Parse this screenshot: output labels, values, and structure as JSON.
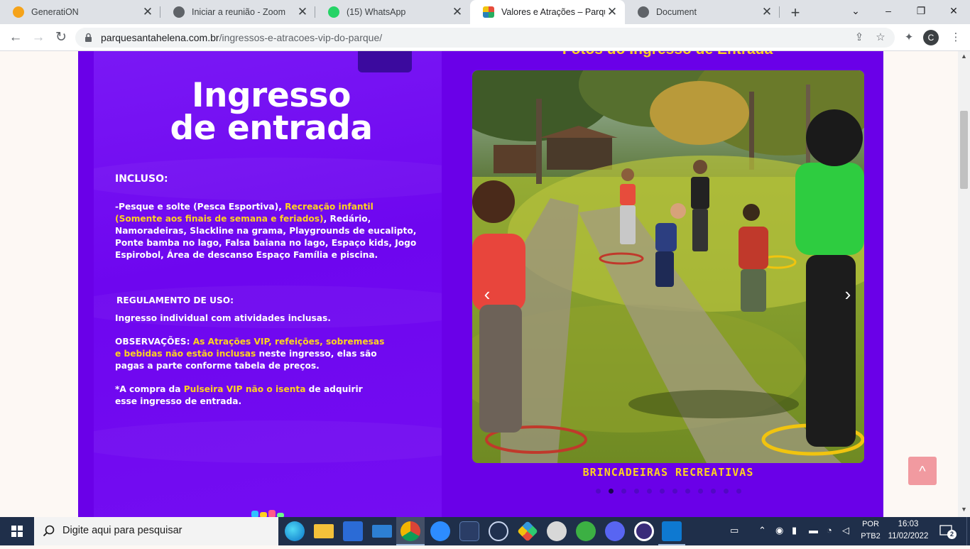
{
  "browser": {
    "tabs": [
      {
        "title": "GeneratiON",
        "favicon_color": "#f5a31a",
        "active": false
      },
      {
        "title": "Iniciar a reunião - Zoom",
        "favicon_color": "#5f6368",
        "active": false
      },
      {
        "title": "(15) WhatsApp",
        "favicon_color": "#25d366",
        "active": false
      },
      {
        "title": "Valores e Atrações – Parque Sa",
        "favicon_color": "#e74c3c",
        "active": true
      },
      {
        "title": "Document",
        "favicon_color": "#5f6368",
        "active": false
      }
    ],
    "window_controls": {
      "minimize": "⌄",
      "min": "–",
      "restore": "❐",
      "close": "✕"
    },
    "address": {
      "domain": "parquesantahelena.com.br",
      "path": "/ingressos-e-atracoes-vip-do-parque/"
    },
    "profile_initial": "C"
  },
  "poster": {
    "title_line1": "Ingresso",
    "title_line2": "de entrada",
    "included_heading": "INCLUSO:",
    "included_text": {
      "p1": "-Pesque e solte ",
      "p2": "(Pesca Esportiva)",
      "p3": ", ",
      "p4": "Recreação infantil",
      "p5": "(Somente aos finais de semana e feriados)",
      "p6": ", Redário, Namoradeiras, Slackline na grama, Playgrounds de eucalipto, Ponte bamba no lago, Falsa baiana no lago, Espaço kids, Jogo Espirobol, Área de descanso ",
      "p7": "Espaço Família",
      "p8": " e piscina."
    },
    "rules_heading": "REGULAMENTO DE USO:",
    "rules_text": "Ingresso individual com atividades inclusas.",
    "obs": {
      "label": "OBSERVAÇÕES: ",
      "highlight": "As Atrações VIP, refeições, sobremesas e bebidas não estão inclusas",
      "rest": " neste ingresso, elas são pagas a parte conforme tabela de preços."
    },
    "note": {
      "a": "*A compra da ",
      "b": "Pulseira VIP",
      "c": " ",
      "d": "não o isenta",
      "e": " de adquirir esse ingresso de entrada."
    }
  },
  "carousel": {
    "title": "Fotos do Ingresso de Entrada",
    "caption": "BRINCADEIRAS RECREATIVAS",
    "prev_icon": "‹",
    "next_icon": "›",
    "total_slides": 12,
    "current_slide": 2
  },
  "back_to_top_icon": "^",
  "taskbar": {
    "search_placeholder": "Digite aqui para pesquisar",
    "language": "POR",
    "keyboard": "PTB2",
    "time": "16:03",
    "date": "11/02/2022",
    "notifications": "2"
  },
  "colors": {
    "section_bg": "#6a00e8",
    "accent_yellow": "#ffd21f",
    "back_to_top": "#f19aa0"
  }
}
